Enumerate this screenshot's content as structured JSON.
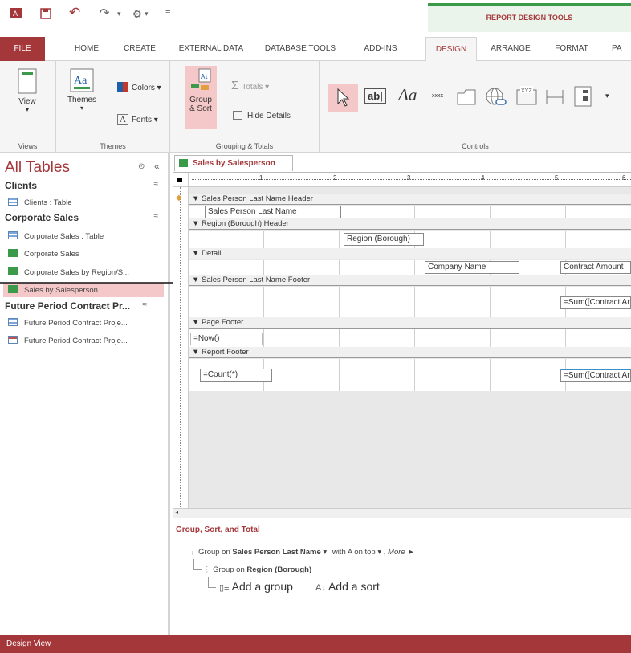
{
  "title_bar": {
    "contextual_tab_group": "REPORT DESIGN TOOLS"
  },
  "tabs": [
    "FILE",
    "HOME",
    "CREATE",
    "EXTERNAL DATA",
    "DATABASE TOOLS",
    "ADD-INS",
    "DESIGN",
    "ARRANGE",
    "FORMAT",
    "PA"
  ],
  "active_tab": "DESIGN",
  "ribbon": {
    "views": {
      "label": "Views",
      "view_button": "View"
    },
    "themes": {
      "label": "Themes",
      "themes_button": "Themes",
      "colors": "Colors",
      "fonts": "Fonts"
    },
    "grouping": {
      "label": "Grouping & Totals",
      "group_sort_line1": "Group",
      "group_sort_line2": "& Sort",
      "totals": "Totals",
      "hide_details": "Hide Details"
    },
    "controls": {
      "label": "Controls",
      "textbox": "ab|",
      "label_ctrl": "Aa",
      "xyz": "XYZ",
      "btn_text": "xxxx"
    }
  },
  "nav": {
    "title": "All Tables",
    "groups": [
      {
        "name": "Clients",
        "items": [
          {
            "label": "Clients : Table",
            "type": "table"
          }
        ]
      },
      {
        "name": "Corporate Sales",
        "items": [
          {
            "label": "Corporate Sales : Table",
            "type": "table"
          },
          {
            "label": "Corporate Sales",
            "type": "report"
          },
          {
            "label": "Corporate Sales by Region/S...",
            "type": "report"
          },
          {
            "label": "Sales by Salesperson",
            "type": "report"
          }
        ]
      },
      {
        "name": "Future Period Contract Pr...",
        "items": [
          {
            "label": "Future Period Contract Proje...",
            "type": "table"
          },
          {
            "label": "Future Period Contract Proje...",
            "type": "form"
          }
        ]
      }
    ]
  },
  "document": {
    "tab_label": "Sales by Salesperson",
    "ruler_numbers": [
      "1",
      "2",
      "3",
      "4",
      "5",
      "6"
    ],
    "sections": {
      "sp_header": "Sales Person Last Name Header",
      "region_header": "Region (Borough) Header",
      "detail": "Detail",
      "sp_footer": "Sales Person Last Name Footer",
      "page_footer": "Page Footer",
      "report_footer": "Report Footer"
    },
    "controls": {
      "sp_last_name": "Sales Person Last Name",
      "region": "Region (Borough)",
      "company": "Company Name",
      "contract": "Contract Amount",
      "sum1": "=Sum([Contract An",
      "now": "=Now()",
      "count": "=Count(*)",
      "sum2": "=Sum([Contract An"
    }
  },
  "group_sort_total": {
    "title": "Group, Sort, and Total",
    "group1_prefix": "Group on",
    "group1_field": "Sales Person Last Name",
    "group1_sort": "with A on top",
    "more": "More ►",
    "group2_prefix": "Group on",
    "group2_field": "Region (Borough)",
    "add_group": "Add a group",
    "add_sort": "Add a sort"
  },
  "status_bar": {
    "text": "Design View"
  },
  "colors": {
    "accent": "#a4373a",
    "ribbon_bg": "#f5f5f5"
  }
}
